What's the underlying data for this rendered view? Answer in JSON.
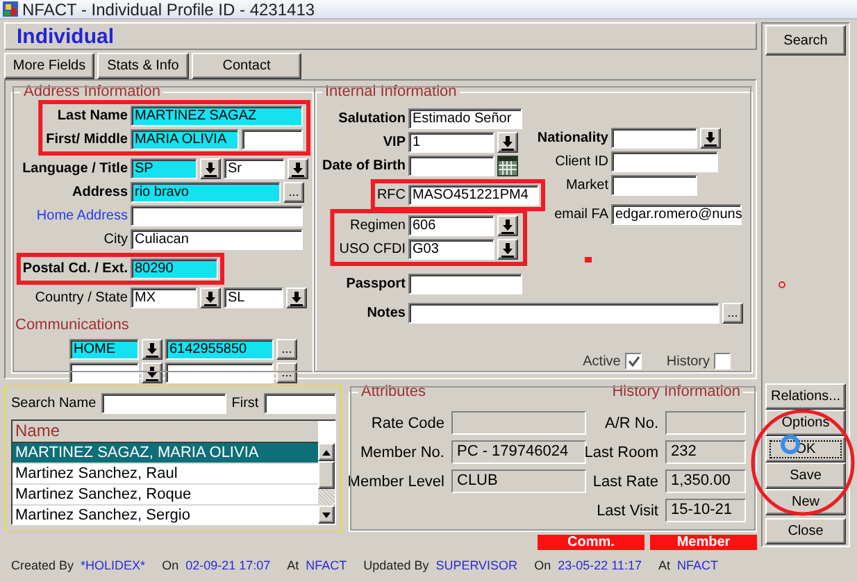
{
  "window": {
    "title": "NFACT - Individual Profile ID - 4231413"
  },
  "header": {
    "title": "Individual"
  },
  "tabs": [
    {
      "label": "More Fields"
    },
    {
      "label": "Stats & Info"
    },
    {
      "label": "Contact"
    }
  ],
  "address": {
    "title": "Address Information",
    "rows": [
      {
        "label": "Last Name",
        "kind": "key",
        "controls": [
          {
            "kind": "text",
            "value": "MARTINEZ SAGAZ",
            "mandatory": true
          }
        ]
      },
      {
        "label": "First/ Middle",
        "kind": "key",
        "controls": [
          {
            "kind": "text",
            "value": "MARIA OLIVIA",
            "mandatory": true
          },
          {
            "kind": "text",
            "mandatory": false
          }
        ]
      },
      {
        "label": "Language / Title",
        "kind": "key",
        "controls": [
          {
            "kind": "dropdown",
            "value": "SP",
            "mandatory": true
          },
          {
            "kind": "dropdown",
            "value": "Sr",
            "mandatory": false
          }
        ]
      },
      {
        "label": "Address",
        "kind": "key",
        "controls": [
          {
            "kind": "lookup",
            "value": "rio bravo",
            "mandatory": true,
            "button": "..."
          }
        ]
      },
      {
        "label": "Home Address",
        "kind": "link",
        "controls": [
          {
            "kind": "text",
            "mandatory": false
          }
        ]
      },
      {
        "label": "City",
        "kind": "normal",
        "controls": [
          {
            "kind": "text",
            "value": "Culiacan",
            "mandatory": false
          }
        ]
      },
      {
        "label": "Postal Cd. / Ext.",
        "kind": "key",
        "controls": [
          {
            "kind": "text",
            "value": "80290",
            "mandatory": true
          }
        ]
      },
      {
        "label": "Country / State",
        "kind": "normal",
        "controls": [
          {
            "kind": "dropdown",
            "value": "MX",
            "mandatory": false
          },
          {
            "kind": "dropdown",
            "value": "SL",
            "mandatory": false
          }
        ]
      }
    ],
    "communications": {
      "title": "Communications",
      "rows": [
        {
          "controls": [
            {
              "kind": "dropdown",
              "value": "HOME",
              "mandatory": true
            },
            {
              "kind": "lookup",
              "value": "6142955850",
              "mandatory": true,
              "button": "..."
            }
          ]
        },
        {
          "controls": [
            {
              "kind": "dropdown",
              "mandatory": false
            },
            {
              "kind": "lookup",
              "mandatory": false,
              "button": "..."
            }
          ]
        }
      ]
    }
  },
  "internal": {
    "title": "Internal Information",
    "left_rows": [
      {
        "label": "Salutation",
        "kind": "key",
        "controls": [
          {
            "kind": "text",
            "value": "Estimado Señor",
            "mandatory": false
          }
        ]
      },
      {
        "label": "VIP",
        "kind": "key",
        "controls": [
          {
            "kind": "dropdown",
            "value": "1",
            "mandatory": false
          }
        ]
      },
      {
        "label": "Date of Birth",
        "kind": "key",
        "controls": [
          {
            "kind": "date",
            "mandatory": false
          }
        ]
      },
      {
        "label": "RFC",
        "kind": "normal",
        "controls": [
          {
            "kind": "text",
            "value": "MASO451221PM4",
            "mandatory": false
          }
        ]
      },
      {
        "label": "Regimen",
        "kind": "normal",
        "controls": [
          {
            "kind": "dropdown",
            "value": "606",
            "mandatory": false
          }
        ]
      },
      {
        "label": "USO CFDI",
        "kind": "normal",
        "controls": [
          {
            "kind": "dropdown",
            "value": "G03",
            "mandatory": false
          }
        ]
      },
      {
        "label": "Passport",
        "kind": "key",
        "controls": [
          {
            "kind": "text",
            "mandatory": false
          }
        ]
      }
    ],
    "right_rows": [
      {
        "label": "Nationality",
        "kind": "key",
        "controls": [
          {
            "kind": "dropdown",
            "mandatory": false
          }
        ]
      },
      {
        "label": "Client ID",
        "kind": "normal",
        "controls": [
          {
            "kind": "text",
            "mandatory": false
          }
        ]
      },
      {
        "label": "Market",
        "kind": "normal",
        "controls": [
          {
            "kind": "text",
            "mandatory": false
          }
        ]
      },
      {
        "label": "email FA",
        "kind": "normal",
        "controls": [
          {
            "kind": "text",
            "value": "edgar.romero@nuns",
            "mandatory": false
          }
        ]
      }
    ],
    "notes": {
      "label": "Notes",
      "kind": "key",
      "controls": [
        {
          "kind": "lookup",
          "mandatory": false,
          "button": "..."
        }
      ]
    },
    "checks": [
      {
        "label": "Active",
        "checked": true
      },
      {
        "label": "History",
        "checked": false
      }
    ]
  },
  "search": {
    "name_label": "Search Name",
    "first_label": "First",
    "list": {
      "header": "Name",
      "rows": [
        {
          "name": "MARTINEZ SAGAZ, MARIA OLIVIA",
          "selected": true
        },
        {
          "name": "Martinez Sanchez, Raul",
          "selected": false
        },
        {
          "name": "Martinez Sanchez, Roque",
          "selected": false
        },
        {
          "name": "Martinez Sanchez, Sergio",
          "selected": false
        }
      ]
    }
  },
  "attributes": {
    "title": "Attributes",
    "history_title": "History Information",
    "left_rows": [
      {
        "label": "Rate Code"
      },
      {
        "label": "Member No.",
        "value": "PC - 179746024"
      },
      {
        "label": "Member Level",
        "value": "CLUB"
      }
    ],
    "right_rows": [
      {
        "label": "A/R No."
      },
      {
        "label": "Last Room",
        "value": "232"
      },
      {
        "label": "Last Rate",
        "value": "1,350.00"
      },
      {
        "label": "Last Visit",
        "value": "15-10-21"
      }
    ]
  },
  "flags": [
    {
      "label": "Comm.",
      "on": true
    },
    {
      "label": "Member",
      "on": true
    }
  ],
  "audit": [
    {
      "label": "Created By",
      "value": "*HOLIDEX*"
    },
    {
      "label": "On",
      "value": "02-09-21 17:07"
    },
    {
      "label": "At",
      "value": "NFACT"
    },
    {
      "label": "Updated By",
      "value": "SUPERVISOR"
    },
    {
      "label": "On",
      "value": "23-05-22 11:17"
    },
    {
      "label": "At",
      "value": "NFACT"
    }
  ],
  "actions": {
    "top": [
      {
        "label": "Search",
        "focused": false
      }
    ],
    "bottom": [
      {
        "label": "Relations...",
        "focused": false
      },
      {
        "label": "Options",
        "focused": false
      },
      {
        "label": "OK",
        "focused": true
      },
      {
        "label": "Save",
        "focused": false
      },
      {
        "label": "New",
        "focused": false
      },
      {
        "label": "Close",
        "focused": false
      }
    ]
  }
}
